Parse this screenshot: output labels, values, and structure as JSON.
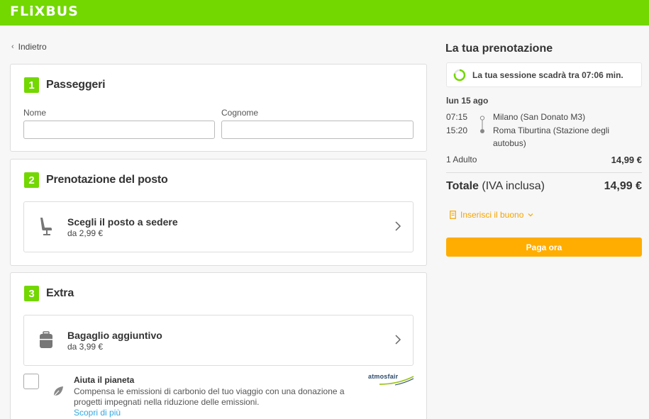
{
  "header": {
    "logo": "FLiXBUS"
  },
  "nav": {
    "back_label": "Indietro"
  },
  "passengers": {
    "step": "1",
    "title": "Passeggeri",
    "first_name_label": "Nome",
    "first_name_value": "",
    "last_name_label": "Cognome",
    "last_name_value": ""
  },
  "seat": {
    "step": "2",
    "title": "Prenotazione del posto",
    "option_title": "Scegli il posto a sedere",
    "option_price": "da 2,99 €"
  },
  "extra": {
    "step": "3",
    "title": "Extra",
    "baggage_title": "Bagaglio aggiuntivo",
    "baggage_price": "da 3,99 €",
    "eco_title": "Aiuta il pianeta",
    "eco_text": "Compensa le emissioni di carbonio del tuo viaggio con una donazione a progetti impegnati nella riduzione delle emissioni.",
    "eco_link": "Scopri di più",
    "partner_logo": "atmosfair"
  },
  "summary": {
    "title": "La tua prenotazione",
    "timer_text": "La tua sessione scadrà tra 07:06 min.",
    "date": "lun 15 ago",
    "departure_time": "07:15",
    "departure_stop": "Milano (San Donato M3)",
    "arrival_time": "15:20",
    "arrival_stop": "Roma Tiburtina (Stazione degli autobus)",
    "pax_label": "1 Adulto",
    "pax_amount": "14,99 €",
    "total_label": "Totale",
    "total_suffix": " (IVA inclusa)",
    "total_amount": "14,99 €",
    "voucher_label": "Inserisci il buono",
    "pay_label": "Paga ora"
  },
  "colors": {
    "brand_green": "#73d700",
    "pay_orange": "#ffad00",
    "voucher_orange": "#f5a400",
    "link_blue": "#31a8e0"
  },
  "icons": [
    "seat-icon",
    "luggage-icon",
    "leaf-icon",
    "chevron-right-icon",
    "timer-ring-icon",
    "voucher-icon",
    "chevron-down-icon",
    "chevron-left-icon"
  ]
}
